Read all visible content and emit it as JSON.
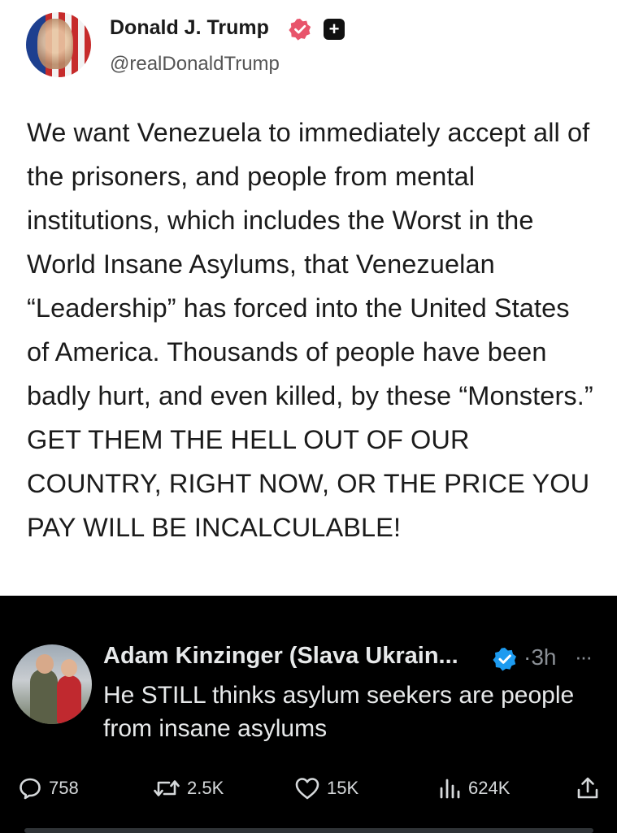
{
  "truth_post": {
    "author_name": "Donald J. Trump",
    "handle": "@realDonaldTrump",
    "plus_badge": "+",
    "body": "We want Venezuela to immediately accept all of the prisoners, and people from mental institutions, which includes the Worst in the World Insane Asylums, that Venezuelan “Leadership” has forced into the United States of America. Thousands of people have been badly hurt, and even killed, by these “Monsters.” GET THEM THE HELL OUT OF OUR COUNTRY, RIGHT NOW, OR THE PRICE YOU PAY WILL BE INCALCULABLE!"
  },
  "x_post": {
    "author_name": "Adam Kinzinger (Slava Ukrain...",
    "time": "·3h",
    "more": "···",
    "body": "He STILL thinks asylum seekers are people from insane asylums",
    "actions": {
      "replies": "758",
      "reposts": "2.5K",
      "likes": "15K",
      "views": "624K"
    }
  },
  "colors": {
    "truth_verified": "#e8546b",
    "x_verified": "#1d9bf0",
    "x_background": "#000000",
    "truth_background": "#ffffff"
  }
}
